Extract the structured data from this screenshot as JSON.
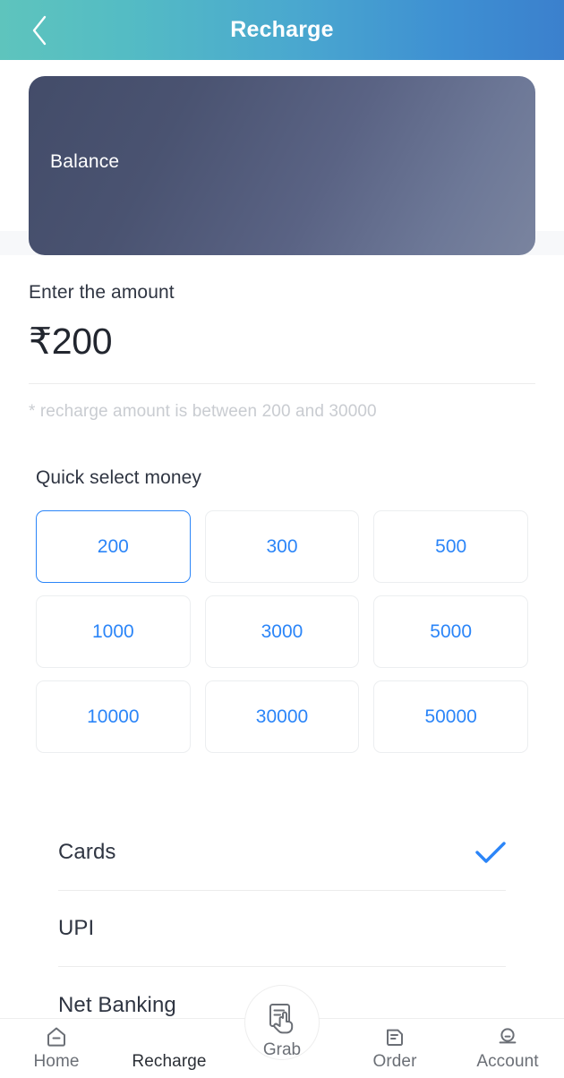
{
  "header": {
    "title": "Recharge",
    "back_icon": "chevron-left-icon",
    "gradient_start": "#5ec4bd",
    "gradient_end": "#3b80cd"
  },
  "balance_card": {
    "label": "Balance",
    "gradient_start": "#434c69",
    "gradient_end": "#7a849f"
  },
  "amount": {
    "label": "Enter the amount",
    "value": "₹200",
    "hint": "* recharge amount is between 200 and 30000"
  },
  "quick_select": {
    "title": "Quick select money",
    "selected": "200",
    "accent": "#2b85f8",
    "options": [
      {
        "label": "200",
        "selected": true
      },
      {
        "label": "300",
        "selected": false
      },
      {
        "label": "500",
        "selected": false
      },
      {
        "label": "1000",
        "selected": false
      },
      {
        "label": "3000",
        "selected": false
      },
      {
        "label": "5000",
        "selected": false
      },
      {
        "label": "10000",
        "selected": false
      },
      {
        "label": "30000",
        "selected": false
      },
      {
        "label": "50000",
        "selected": false
      }
    ]
  },
  "payment_methods": {
    "selected": "Cards",
    "check_color": "#2b85f8",
    "items": [
      {
        "label": "Cards",
        "selected": true
      },
      {
        "label": "UPI",
        "selected": false
      },
      {
        "label": "Net Banking",
        "selected": false
      }
    ]
  },
  "bottom_nav": {
    "active": "Recharge",
    "items": [
      {
        "label": "Home",
        "icon": "home-icon",
        "active": false
      },
      {
        "label": "Recharge",
        "icon": "",
        "active": true
      },
      {
        "label": "Grab",
        "icon": "grab-hand-document-icon",
        "active": false,
        "center": true
      },
      {
        "label": "Order",
        "icon": "order-document-icon",
        "active": false
      },
      {
        "label": "Account",
        "icon": "account-person-icon",
        "active": false
      }
    ]
  }
}
